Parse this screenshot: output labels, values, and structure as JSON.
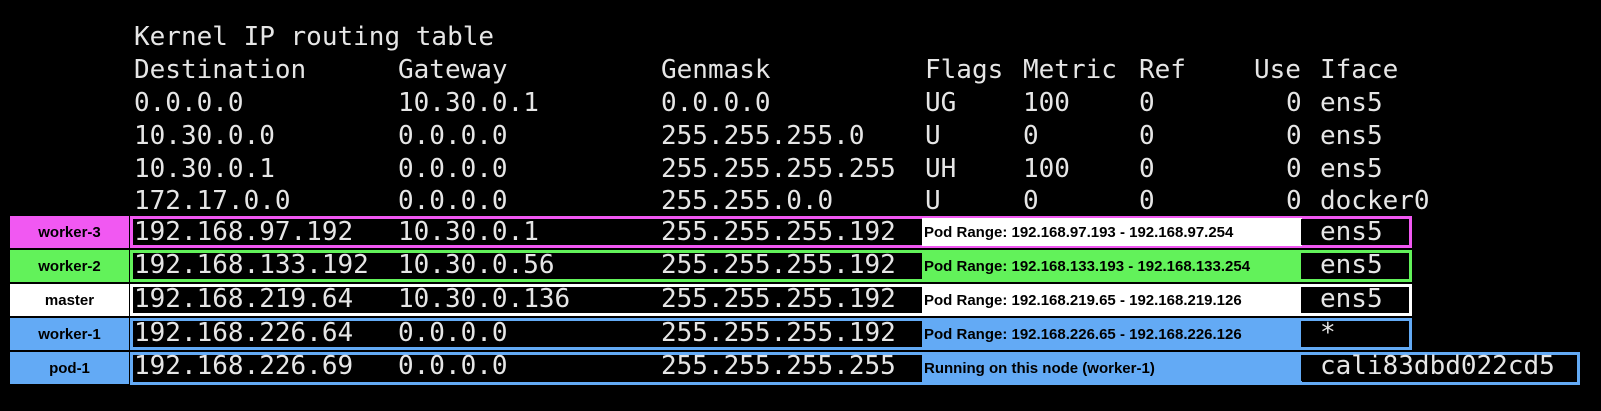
{
  "title": "Kernel IP routing table",
  "headers": [
    "Destination",
    "Gateway",
    "Genmask",
    "Flags",
    "Metric",
    "Ref",
    "Use",
    "Iface"
  ],
  "plain_rows": [
    [
      "0.0.0.0",
      "10.30.0.1",
      "0.0.0.0",
      "UG",
      "100",
      "0",
      "0",
      "ens5"
    ],
    [
      "10.30.0.0",
      "0.0.0.0",
      "255.255.255.0",
      "U",
      "0",
      "0",
      "0",
      "ens5"
    ],
    [
      "10.30.0.1",
      "0.0.0.0",
      "255.255.255.255",
      "UH",
      "100",
      "0",
      "0",
      "ens5"
    ],
    [
      "172.17.0.0",
      "0.0.0.0",
      "255.255.0.0",
      "U",
      "0",
      "0",
      "0",
      "docker0"
    ]
  ],
  "annotated_rows": [
    {
      "label": "worker-3",
      "color": "#f158f2",
      "dest": "192.168.97.192",
      "gateway": "10.30.0.1",
      "genmask": "255.255.255.192",
      "note": "Pod Range:  192.168.97.193 - 192.168.97.254",
      "iface": "ens5"
    },
    {
      "label": "worker-2",
      "color": "#62f25a",
      "dest": "192.168.133.192",
      "gateway": "10.30.0.56",
      "genmask": "255.255.255.192",
      "note": "Pod Range: 192.168.133.193 - 192.168.133.254",
      "iface": "ens5"
    },
    {
      "label": "master",
      "color": "#ffffff",
      "dest": "192.168.219.64",
      "gateway": "10.30.0.136",
      "genmask": "255.255.255.192",
      "note": "Pod Range: 192.168.219.65 - 192.168.219.126",
      "iface": "ens5"
    },
    {
      "label": "worker-1",
      "color": "#63aaf5",
      "dest": "192.168.226.64",
      "gateway": "0.0.0.0",
      "genmask": "255.255.255.192",
      "note": "Pod Range:  192.168.226.65 - 192.168.226.126",
      "iface": "*"
    },
    {
      "label": "pod-1",
      "color": "#63aaf5",
      "dest": "192.168.226.69",
      "gateway": "0.0.0.0",
      "genmask": "255.255.255.255",
      "note": "Running on this node (worker-1)",
      "iface": "cali83dbd022cd5"
    }
  ]
}
